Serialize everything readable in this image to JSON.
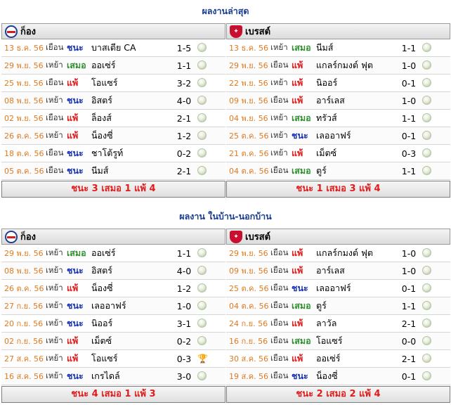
{
  "recent": {
    "title": "ผลงานล่าสุด",
    "left": {
      "team": "ก็อง",
      "matches": [
        {
          "date": "13 ธ.ค. 56",
          "venue": "เยือน",
          "result": "ชนะ",
          "opponent": "บาสเตีย CA",
          "score": "1-5",
          "icon": "ball-icon"
        },
        {
          "date": "29 พ.ย. 56",
          "venue": "เหย้า",
          "result": "เสมอ",
          "opponent": "ออเซ่ร์",
          "score": "1-1",
          "icon": "ball-icon"
        },
        {
          "date": "25 พ.ย. 56",
          "venue": "เยือน",
          "result": "แพ้",
          "opponent": "โอแซร์",
          "score": "3-2",
          "icon": "ball-icon"
        },
        {
          "date": "08 พ.ย. 56",
          "venue": "เหย้า",
          "result": "ชนะ",
          "opponent": "อิสตร์",
          "score": "4-0",
          "icon": "ball-icon"
        },
        {
          "date": "02 พ.ย. 56",
          "venue": "เยือน",
          "result": "แพ้",
          "opponent": "ล็องส์",
          "score": "2-1",
          "icon": "ball-icon"
        },
        {
          "date": "26 ต.ค. 56",
          "venue": "เหย้า",
          "result": "แพ้",
          "opponent": "น็องซี่",
          "score": "1-2",
          "icon": "ball-icon"
        },
        {
          "date": "18 ต.ค. 56",
          "venue": "เยือน",
          "result": "ชนะ",
          "opponent": "ชาโต้รูท์",
          "score": "0-2",
          "icon": "ball-icon"
        },
        {
          "date": "05 ต.ค. 56",
          "venue": "เยือน",
          "result": "ชนะ",
          "opponent": "นีมส์",
          "score": "2-1",
          "icon": "ball-icon"
        }
      ],
      "summary": "ชนะ 3 เสมอ 1 แพ้ 4"
    },
    "right": {
      "team": "เบรสต์",
      "matches": [
        {
          "date": "13 ธ.ค. 56",
          "venue": "เหย้า",
          "result": "เสมอ",
          "opponent": "นีมส์",
          "score": "1-1",
          "icon": "ball-icon"
        },
        {
          "date": "29 พ.ย. 56",
          "venue": "เยือน",
          "result": "แพ้",
          "opponent": "แกลร์กมงต์ ฟุต",
          "score": "1-0",
          "icon": "ball-icon"
        },
        {
          "date": "22 พ.ย. 56",
          "venue": "เหย้า",
          "result": "แพ้",
          "opponent": "นิออร์",
          "score": "0-1",
          "icon": "ball-icon"
        },
        {
          "date": "09 พ.ย. 56",
          "venue": "เยือน",
          "result": "แพ้",
          "opponent": "อาร์เลส",
          "score": "1-0",
          "icon": "ball-icon"
        },
        {
          "date": "04 พ.ย. 56",
          "venue": "เหย้า",
          "result": "เสมอ",
          "opponent": "ทรัวส์",
          "score": "1-1",
          "icon": "ball-icon"
        },
        {
          "date": "25 ต.ค. 56",
          "venue": "เหย้า",
          "result": "ชนะ",
          "opponent": "เลออาฟร์",
          "score": "0-1",
          "icon": "ball-icon"
        },
        {
          "date": "21 ต.ค. 56",
          "venue": "เหย้า",
          "result": "แพ้",
          "opponent": "เม็ตซ์",
          "score": "0-3",
          "icon": "ball-icon"
        },
        {
          "date": "04 ต.ค. 56",
          "venue": "เยือน",
          "result": "เสมอ",
          "opponent": "ตูร์",
          "score": "1-1",
          "icon": "ball-icon"
        }
      ],
      "summary": "ชนะ 1 เสมอ 3 แพ้ 4"
    }
  },
  "homeaway": {
    "title": "ผลงาน ในบ้าน-นอกบ้าน",
    "left": {
      "team": "ก็อง",
      "matches": [
        {
          "date": "29 พ.ย. 56",
          "venue": "เหย้า",
          "result": "เสมอ",
          "opponent": "ออเซ่ร์",
          "score": "1-1",
          "icon": "ball-icon"
        },
        {
          "date": "08 พ.ย. 56",
          "venue": "เหย้า",
          "result": "ชนะ",
          "opponent": "อิสตร์",
          "score": "4-0",
          "icon": "ball-icon"
        },
        {
          "date": "26 ต.ค. 56",
          "venue": "เหย้า",
          "result": "แพ้",
          "opponent": "น็องซี่",
          "score": "1-2",
          "icon": "ball-icon"
        },
        {
          "date": "27 ก.ย. 56",
          "venue": "เหย้า",
          "result": "ชนะ",
          "opponent": "เลออาฟร์",
          "score": "1-0",
          "icon": "ball-icon"
        },
        {
          "date": "20 ก.ย. 56",
          "venue": "เหย้า",
          "result": "ชนะ",
          "opponent": "นิออร์",
          "score": "3-1",
          "icon": "ball-icon"
        },
        {
          "date": "02 ก.ย. 56",
          "venue": "เหย้า",
          "result": "แพ้",
          "opponent": "เม็ตซ์",
          "score": "0-2",
          "icon": "ball-icon"
        },
        {
          "date": "27 ส.ค. 56",
          "venue": "เหย้า",
          "result": "แพ้",
          "opponent": "โอแซร์",
          "score": "0-3",
          "icon": "trophy-icon"
        },
        {
          "date": "16 ส.ค. 56",
          "venue": "เหย้า",
          "result": "ชนะ",
          "opponent": "เกรไดล์",
          "score": "3-0",
          "icon": "ball-icon"
        }
      ],
      "summary": "ชนะ 4 เสมอ 1 แพ้ 3"
    },
    "right": {
      "team": "เบรสต์",
      "matches": [
        {
          "date": "29 พ.ย. 56",
          "venue": "เยือน",
          "result": "แพ้",
          "opponent": "แกลร์กมงต์ ฟุต",
          "score": "1-0",
          "icon": "ball-icon"
        },
        {
          "date": "09 พ.ย. 56",
          "venue": "เยือน",
          "result": "แพ้",
          "opponent": "อาร์เลส",
          "score": "1-0",
          "icon": "ball-icon"
        },
        {
          "date": "25 ต.ค. 56",
          "venue": "เยือน",
          "result": "ชนะ",
          "opponent": "เลออาฟร์",
          "score": "0-1",
          "icon": "ball-icon"
        },
        {
          "date": "04 ต.ค. 56",
          "venue": "เยือน",
          "result": "เสมอ",
          "opponent": "ตูร์",
          "score": "1-1",
          "icon": "ball-icon"
        },
        {
          "date": "24 ก.ย. 56",
          "venue": "เยือน",
          "result": "แพ้",
          "opponent": "ลาวัล",
          "score": "2-1",
          "icon": "ball-icon"
        },
        {
          "date": "16 ก.ย. 56",
          "venue": "เยือน",
          "result": "เสมอ",
          "opponent": "โอแซร์",
          "score": "0-0",
          "icon": "ball-icon"
        },
        {
          "date": "30 ส.ค. 56",
          "venue": "เยือน",
          "result": "แพ้",
          "opponent": "ออเซ่ร์",
          "score": "2-1",
          "icon": "ball-icon"
        },
        {
          "date": "19 ส.ค. 56",
          "venue": "เยือน",
          "result": "ชนะ",
          "opponent": "น็องซี่",
          "score": "0-1",
          "icon": "ball-icon"
        }
      ],
      "summary": "ชนะ 2 เสมอ 2 แพ้ 4"
    }
  },
  "colors": {
    "title": "#1a3d8f",
    "win": "#1a33b5",
    "draw": "#2f8f2f",
    "lose": "#e01b1b",
    "date": "#e07a1f"
  }
}
